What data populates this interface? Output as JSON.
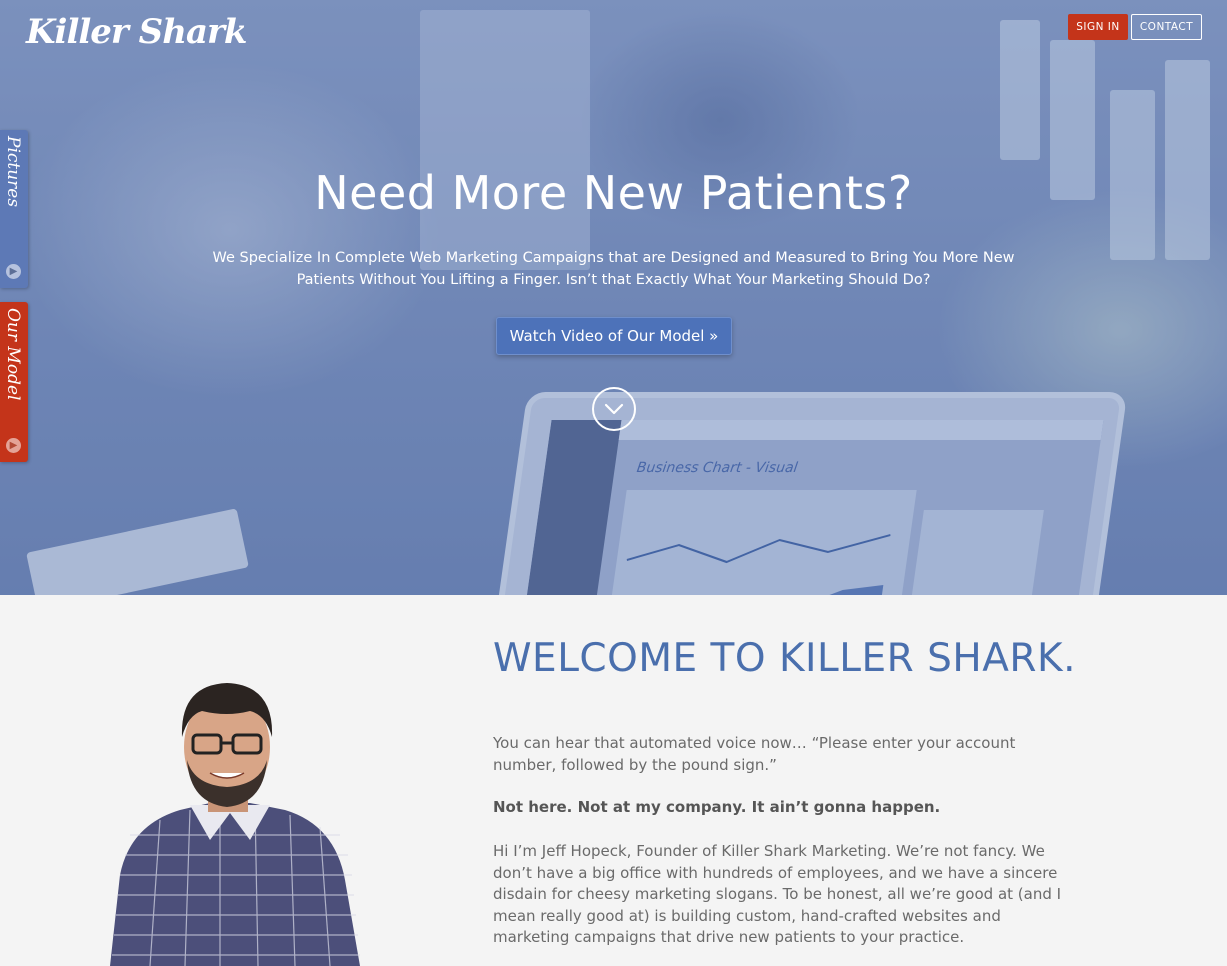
{
  "brand": {
    "logo_text": "Killer Shark"
  },
  "header": {
    "sign_in_label": "SIGN IN",
    "contact_label": "CONTACT"
  },
  "side_tabs": [
    {
      "label": "Pictures",
      "color": "#5d79b6"
    },
    {
      "label": "Our Model",
      "color": "#c4341a"
    }
  ],
  "hero": {
    "title": "Need More New Patients?",
    "subtitle": "We Specialize In Complete Web Marketing Campaigns that are Designed and Measured to Bring You More New Patients Without You Lifting a Finger. Isn’t that Exactly What Your Marketing Should Do?",
    "cta_label": "Watch Video of Our Model »",
    "scroll_icon": "chevron-down-icon"
  },
  "laptop_screen": {
    "chart_title": "Business Chart - Visual"
  },
  "welcome": {
    "heading": "WELCOME TO KILLER SHARK.",
    "paragraphs": [
      "You can hear that automated voice now… “Please enter your account number, followed by the pound sign.”",
      "Not here. Not at my company. It ain’t gonna happen.",
      "Hi I’m Jeff Hopeck, Founder of Killer Shark Marketing. We’re not fancy. We don’t have a big office with hundreds of employees, and we have a sincere disdain for cheesy marketing slogans. To be honest, all we’re good at (and I mean really good at) is building custom, hand-crafted websites and marketing campaigns that drive new patients to your practice."
    ]
  },
  "colors": {
    "accent_red": "#c4341a",
    "accent_blue": "#4a6fad",
    "hero_overlay": "#5470aa"
  }
}
